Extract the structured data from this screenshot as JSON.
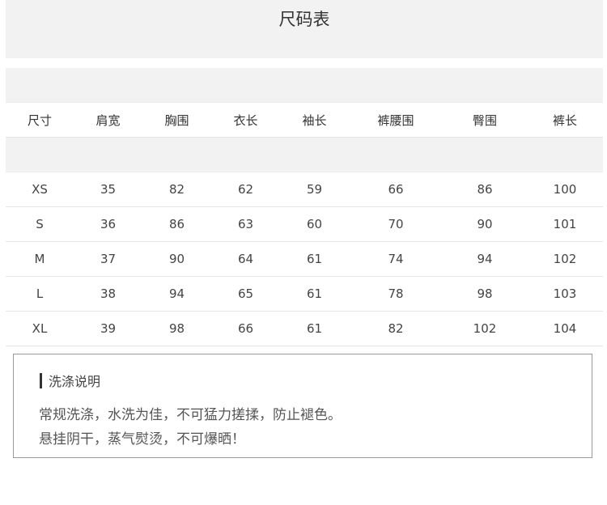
{
  "title": "尺码表",
  "columns": [
    "尺寸",
    "肩宽",
    "胸围",
    "衣长",
    "袖长",
    "裤腰围",
    "臀围",
    "裤长"
  ],
  "rows": [
    [
      "XS",
      "35",
      "82",
      "62",
      "59",
      "66",
      "86",
      "100"
    ],
    [
      "S",
      "36",
      "86",
      "63",
      "60",
      "70",
      "90",
      "101"
    ],
    [
      "M",
      "37",
      "90",
      "64",
      "61",
      "74",
      "94",
      "102"
    ],
    [
      "L",
      "38",
      "94",
      "65",
      "61",
      "78",
      "98",
      "103"
    ],
    [
      "XL",
      "39",
      "98",
      "66",
      "61",
      "82",
      "102",
      "104"
    ]
  ],
  "care": {
    "title": "洗涤说明",
    "lines": [
      "常规洗涤，水洗为佳，不可猛力搓揉，防止褪色。",
      "悬挂阴干，蒸气熨烫，不可爆晒！"
    ]
  }
}
